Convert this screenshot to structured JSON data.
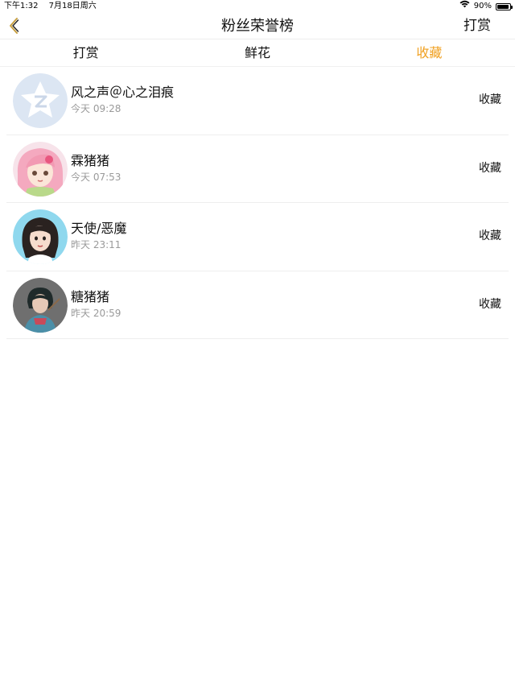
{
  "status_bar": {
    "time": "下午1:32",
    "date": "7月18日周六",
    "battery": "90%",
    "battery_level": 0.9
  },
  "nav": {
    "title": "粉丝荣誉榜",
    "right_label": "打赏"
  },
  "tabs": [
    {
      "label": "打赏",
      "active": false
    },
    {
      "label": "鲜花",
      "active": false
    },
    {
      "label": "收藏",
      "active": true
    }
  ],
  "colors": {
    "accent": "#f0a020",
    "divider": "#eeeeee",
    "subtext": "#9a9a9a"
  },
  "list": [
    {
      "name": "风之声＠心之泪痕",
      "time": "今天 09:28",
      "action": "收藏",
      "avatar": "default-star-avatar"
    },
    {
      "name": "霖猪猪",
      "time": "今天 07:53",
      "action": "收藏",
      "avatar": "pink-hair-girl-avatar"
    },
    {
      "name": "天使/恶魔",
      "time": "昨天 23:11",
      "action": "收藏",
      "avatar": "dark-hair-girl-avatar"
    },
    {
      "name": "糖猪猪",
      "time": "昨天 20:59",
      "action": "收藏",
      "avatar": "illustrated-woman-avatar"
    }
  ]
}
